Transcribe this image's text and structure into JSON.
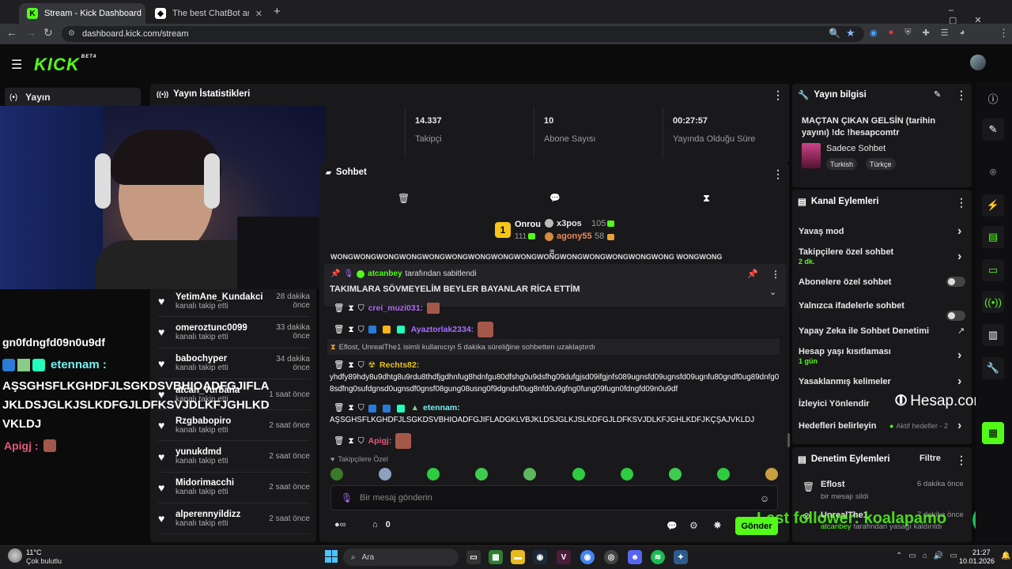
{
  "browser": {
    "tabs": [
      {
        "title": "Stream - Kick Dashboard",
        "active": true
      },
      {
        "title": "The best ChatBot and Widgets",
        "active": false
      }
    ],
    "new_tab": "+",
    "url": "dashboard.kick.com/stream"
  },
  "header": {
    "logo": "KICK",
    "beta": "BETA"
  },
  "sidebar": {
    "nav_label": "Yayın"
  },
  "overlay": {
    "long_text": "gn0fdngfd09n0u9df",
    "user": "etennam :",
    "message_line1": "AŞSGHSFLKGHDFJLSGKDSVBHIOADFGJIFLA",
    "message_line2": "JKLDSJGLKJSLKDFGJLDFKSVJDLKFJGHLKD",
    "message_line3": "VKLDJ",
    "user2": "Apigj :",
    "hesap_logo": "Hesap.com.tr",
    "last_follower": "Last follower: koalapamo"
  },
  "stats": {
    "title": "Yayın İstatistikleri",
    "items": [
      {
        "value": "14.337",
        "label": "Takipçi"
      },
      {
        "value": "10",
        "label": "Abone Sayısı"
      },
      {
        "value": "00:27:57",
        "label": "Yayında Olduğu Süre"
      }
    ]
  },
  "followers": [
    {
      "name": "YetimAne_Kundakcisi1",
      "sub": "kanalı takip etti",
      "time": "28 dakika önce"
    },
    {
      "name": "omeroztunc0099",
      "sub": "kanalı takip etti",
      "time": "33 dakika önce"
    },
    {
      "name": "babochyper",
      "sub": "kanalı takip etti",
      "time": "34 dakika önce"
    },
    {
      "name": "atcan_vurbana",
      "sub": "kanalı takip etti",
      "time": "1 saat önce"
    },
    {
      "name": "Rzgbabopiro",
      "sub": "kanalı takip etti",
      "time": "2 saat önce"
    },
    {
      "name": "yunukdmd",
      "sub": "kanalı takip etti",
      "time": "2 saat önce"
    },
    {
      "name": "Midorimacchi",
      "sub": "kanalı takip etti",
      "time": "2 saat önce"
    },
    {
      "name": "alperennyildizz",
      "sub": "kanalı takip etti",
      "time": "2 saat önce"
    }
  ],
  "chat": {
    "title": "Sohbet",
    "leaderboard": {
      "rank": "1",
      "first_name": "Onrou",
      "first_score": "111",
      "second_name": "x3pos",
      "second_score": "105",
      "third_name": "agony55",
      "third_score": "58"
    },
    "ticker": "WONGWONGWONGWONGWONGWONGWONGWONGWONGWONGWONGWONGWONGWONGWONG WONGWONG",
    "pinned": {
      "by_user": "atcanbey",
      "by_text": "tarafından sabitlendi",
      "message": "TAKIMLARA SÖVMEYELİM BEYLER BAYANLAR RİCA ETTİM"
    },
    "messages": {
      "m0_user": "crei_muzi031:",
      "m1_user": "Ayaztorlak2334:",
      "system": "Eflost, UnrealThe1 isimli kullanıcıyı 5 dakika süreliğine sohbetten uzaklaştırdı",
      "m2_user": "Rechts82:",
      "m2_text": "yhdfy89hdy8u9dhtg8u9rdu8thdfjgdhnfug8hdnfgu80dfshg0u9dsfhg09dufgjsd09ifgjnfs089ugnsfd09ugnsfd09ugnfu80gndf0ug89dnfg08sdfng0sufdgnsd0ugnsdf0gnsf08gung08usng0f9dgndsf0ug8nfd0u9gfng0fung09fugn0fdngfd09n0u9df",
      "m3_user": "etennam:",
      "m3_text": "AŞSGHSFLKGHDFJLSGKDSVBHIOADFGJIFLADGKLVBJKLDSJGLKJSLKDFGJLDFKSVJDLKFJGHLKDFJKÇŞAJVKLDJ",
      "m4_user": "Apigj:"
    },
    "followers_only": "Takipçilere Özel",
    "input_placeholder": "Bir mesaj gönderin",
    "counter": "0",
    "send": "Gönder"
  },
  "stream_info": {
    "title": "Yayın bilgisi",
    "stream_title": "MAÇTAN ÇIKAN GELSİN (tarihin yayını) !dc !hesapcomtr",
    "category": "Sadece Sohbet",
    "tags": [
      "Turkish",
      "Türkçe"
    ]
  },
  "channel_actions": {
    "title": "Kanal Eylemleri",
    "slow_mode": "Yavaş mod",
    "followers_chat": "Takipçilere özel sohbet",
    "followers_chat_sub": "2 dk.",
    "subs_chat": "Abonelere özel sohbet",
    "emote_chat": "Yalnızca ifadelerle sohbet",
    "ai_moderation": "Yapay Zeka ile Sohbet Denetimi",
    "age_restriction": "Hesap yaşı kısıtlaması",
    "age_restriction_sub": "1 gün",
    "banned_words": "Yasaklanmış kelimeler",
    "viewer_redirect": "İzleyici Yönlendir",
    "goals": "Hedefleri belirleyin",
    "goals_status": "Aktif hedefler - 2"
  },
  "moderation": {
    "title": "Denetim Eylemleri",
    "filter": "Filtre",
    "items": [
      {
        "user": "Eflost",
        "text": "bir mesajı sildi",
        "time": "6 dakika önce"
      },
      {
        "user": "UnrealThe1",
        "by": "atcanbey",
        "text": "tarafından yasağı kaldırıldı",
        "time": "7 dakika önce"
      }
    ]
  },
  "taskbar": {
    "temp": "11°C",
    "weather": "Çok bulutlu",
    "search": "Ara",
    "time": "21:27",
    "date": "10.01.2026"
  },
  "colors": {
    "accent": "#53fc18",
    "panel": "#19191c",
    "bg": "#0b0b0c"
  }
}
